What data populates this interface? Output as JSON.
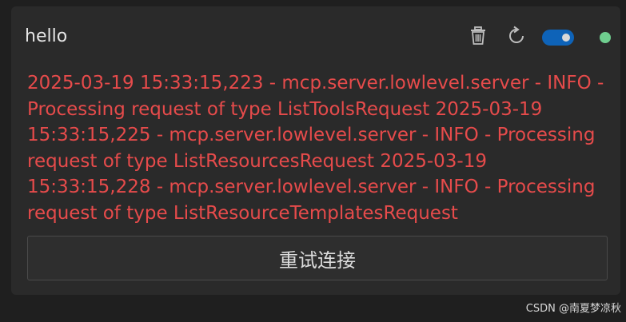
{
  "server": {
    "name": "hello",
    "enabled": true,
    "status_color": "#6fce8f"
  },
  "actions": {
    "delete_icon": "trash-icon",
    "refresh_icon": "refresh-icon"
  },
  "error_log": "2025-03-19 15:33:15,223 - mcp.server.lowlevel.server - INFO - Processing request of type ListToolsRequest 2025-03-19 15:33:15,225 - mcp.server.lowlevel.server - INFO - Processing request of type ListResourcesRequest 2025-03-19 15:33:15,228 - mcp.server.lowlevel.server - INFO - Processing request of type ListResourceTemplatesRequest",
  "retry_button_label": "重试连接",
  "watermark": "CSDN @南夏梦凉秋",
  "colors": {
    "error_text": "#e64b4b",
    "toggle_on": "#0e63b8",
    "card_background": "#2a2a2a"
  }
}
